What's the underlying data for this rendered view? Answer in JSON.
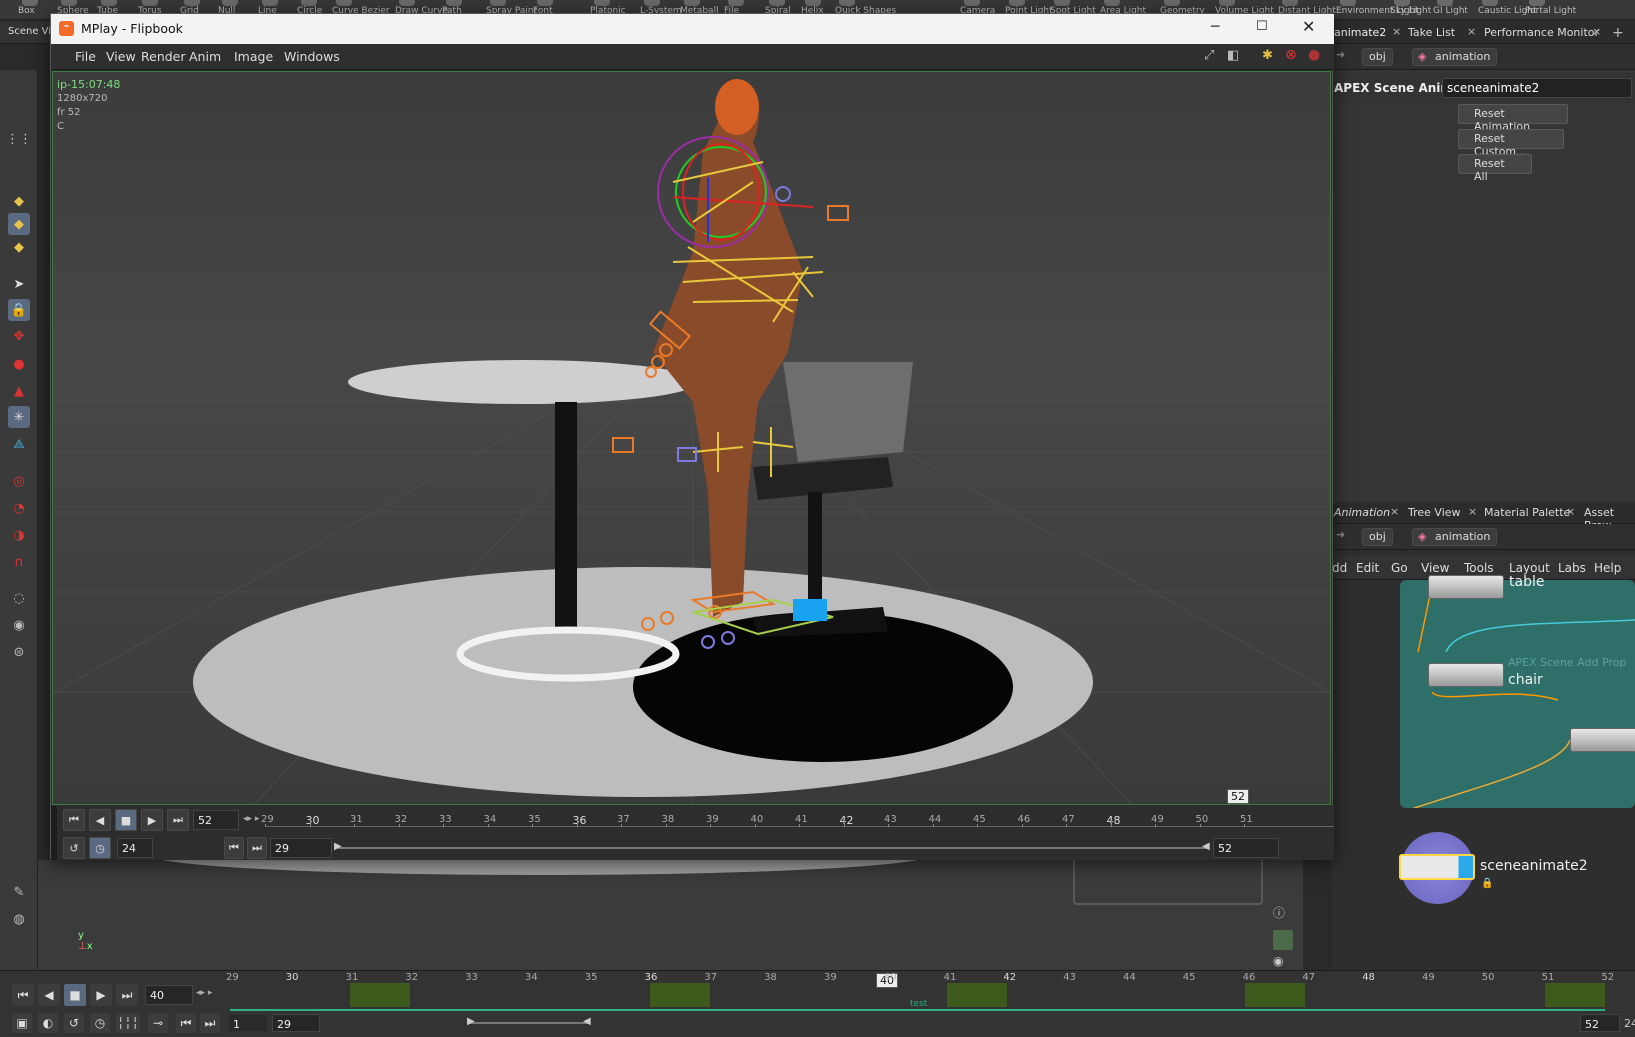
{
  "shelf": {
    "items": [
      "Box",
      "Sphere",
      "Tube",
      "Torus",
      "Grid",
      "Null",
      "Line",
      "Circle",
      "Curve Bezier",
      "Draw Curve",
      "Path",
      "Spray Paint",
      "Font",
      "Platonic",
      "L-System",
      "Metaball",
      "File",
      "Spiral",
      "Helix",
      "Quick Shapes",
      "Camera",
      "Point Light",
      "Spot Light",
      "Area Light",
      "Geometry",
      "Volume Light",
      "Distant Light",
      "Environment Light",
      "Sky Light",
      "GI Light",
      "Caustic Light",
      "Portal Light"
    ]
  },
  "scene_tabs": {
    "scene_view": "Scene Vie"
  },
  "flipbook": {
    "window_title": "MPlay - Flipbook",
    "menu": [
      "File",
      "View",
      "Render",
      "Anim",
      "Image",
      "Windows"
    ],
    "overlay": {
      "image_name": "ip-15:07:48",
      "resolution": "1280x720",
      "frame": "fr 52",
      "channel": "C"
    },
    "current_frame": "52",
    "fps": "24",
    "range_start": "29",
    "range_end": "52",
    "ruler_marker": "52",
    "ticks": [
      "29",
      "30",
      "31",
      "32",
      "33",
      "34",
      "35",
      "36",
      "37",
      "38",
      "39",
      "40",
      "41",
      "42",
      "43",
      "44",
      "45",
      "46",
      "47",
      "48",
      "49",
      "50",
      "51"
    ]
  },
  "right_top": {
    "tabs": [
      "animate2",
      "Take List",
      "Performance Monitor"
    ],
    "path": {
      "root": "obj",
      "node": "animation"
    },
    "node_type": "APEX Scene Animate",
    "node_name": "sceneanimate2",
    "buttons": [
      "Reset Animation",
      "Reset Custom...",
      "Reset All"
    ]
  },
  "right_bottom": {
    "tabs": [
      "Animation",
      "Tree View",
      "Material Palette",
      "Asset Brow"
    ],
    "path": {
      "root": "obj",
      "node": "animation"
    },
    "menu": [
      "dd",
      "Edit",
      "Go",
      "View",
      "Tools",
      "Layout",
      "Labs",
      "Help"
    ],
    "nodes": {
      "table": "table",
      "chair": "chair",
      "chair_sub": "APEX Scene Add Prop",
      "current": "sceneanimate2"
    }
  },
  "playbar": {
    "current_frame": "40",
    "start": "1",
    "range_start": "29",
    "end": "52",
    "end_tail": "24",
    "marker": "40",
    "track_label": "test",
    "ticks": [
      "29",
      "30",
      "31",
      "32",
      "33",
      "34",
      "35",
      "36",
      "37",
      "38",
      "39",
      "40",
      "41",
      "42",
      "43",
      "44",
      "45",
      "46",
      "47",
      "48",
      "49",
      "50",
      "51",
      "52"
    ]
  },
  "colors": {
    "accent_green": "#3d7a3d",
    "network_bg": "#2e6f69",
    "key_block": "#3e5a1c",
    "current_node": "#ffd84a"
  }
}
